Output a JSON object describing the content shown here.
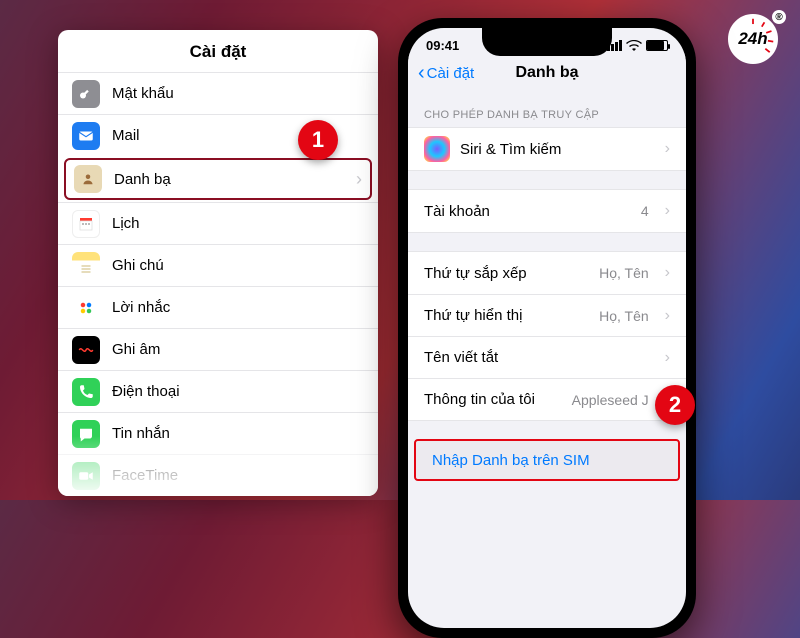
{
  "logo": {
    "text": "24h",
    "registered": "®"
  },
  "markers": {
    "one": "1",
    "two": "2"
  },
  "left": {
    "title": "Cài đặt",
    "items": [
      {
        "label": "Mật khẩu"
      },
      {
        "label": "Mail"
      },
      {
        "label": "Danh bạ",
        "highlight": true
      },
      {
        "label": "Lịch"
      },
      {
        "label": "Ghi chú"
      },
      {
        "label": "Lời nhắc"
      },
      {
        "label": "Ghi âm"
      },
      {
        "label": "Điện thoại"
      },
      {
        "label": "Tin nhắn"
      },
      {
        "label": "FaceTime"
      }
    ]
  },
  "phone": {
    "status": {
      "time": "09:41",
      "signal": "signal",
      "wifi": "wifi",
      "battery": "battery"
    },
    "nav": {
      "back": "Cài đặt",
      "title": "Danh bạ"
    },
    "section_header": "CHO PHÉP DANH BẠ TRUY CẬP",
    "siri": {
      "label": "Siri & Tìm kiếm"
    },
    "accounts": {
      "label": "Tài khoản",
      "value": "4"
    },
    "sort": {
      "label": "Thứ tự sắp xếp",
      "value": "Họ, Tên"
    },
    "display": {
      "label": "Thứ tự hiển thị",
      "value": "Họ, Tên"
    },
    "shortname": {
      "label": "Tên viết tắt"
    },
    "myinfo": {
      "label": "Thông tin của tôi",
      "value": "Appleseed J"
    },
    "sim": {
      "label": "Nhập Danh bạ trên SIM"
    }
  }
}
